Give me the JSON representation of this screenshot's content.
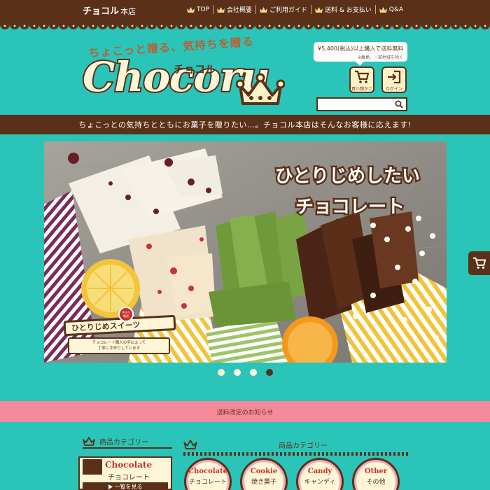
{
  "topbar": {
    "brand": "チョコル",
    "brand_sub": "本店",
    "nav": [
      "TOP",
      "会社概要",
      "ご利用ガイド",
      "送料 & お支払い",
      "Q&A"
    ]
  },
  "header": {
    "tagline": "ちょこっと贈る、気持ちを贈る",
    "logo_text": "Chocoru",
    "logo_kana": "チョコル",
    "shipping_main": "¥5,400(税込)以上購入で送料無料",
    "shipping_note": "※離島、一部地域を除く",
    "cart_label": "買い物かご",
    "login_label": "ログイン",
    "search_placeholder": ""
  },
  "band_text": "ちょこっとの気持ちとともにお菓子を贈りたい…。チョコル本店はそんなお客様に応えます!",
  "hero": {
    "title_line1": "ひとりじめしたい",
    "title_line2": "チョコレート",
    "badge_title": "ひとりじめスイーツ",
    "badge_seal_1": "手作り",
    "badge_seal_2": "製造",
    "badge_caption_1": "チョコレート職人の手によって",
    "badge_caption_2": "丁寧に手作りしています",
    "slides": 4,
    "active_slide": 4
  },
  "notice": "送料改定のお知らせ",
  "sidebar": {
    "heading": "商品カテゴリー",
    "card_title": "Chocolate",
    "card_sub": "チョコレート",
    "more": "一覧を見る"
  },
  "main": {
    "heading": "商品カテゴリー",
    "categories": [
      {
        "en": "Chocolate",
        "jp": "チョコレート"
      },
      {
        "en": "Cookie",
        "jp": "焼き菓子"
      },
      {
        "en": "Candy",
        "jp": "キャンディ"
      },
      {
        "en": "Other",
        "jp": "その他"
      }
    ]
  },
  "colors": {
    "teal": "#2bc4b8",
    "brown": "#5a3118",
    "cream": "#fff6d8",
    "pink": "#f58a9a"
  }
}
